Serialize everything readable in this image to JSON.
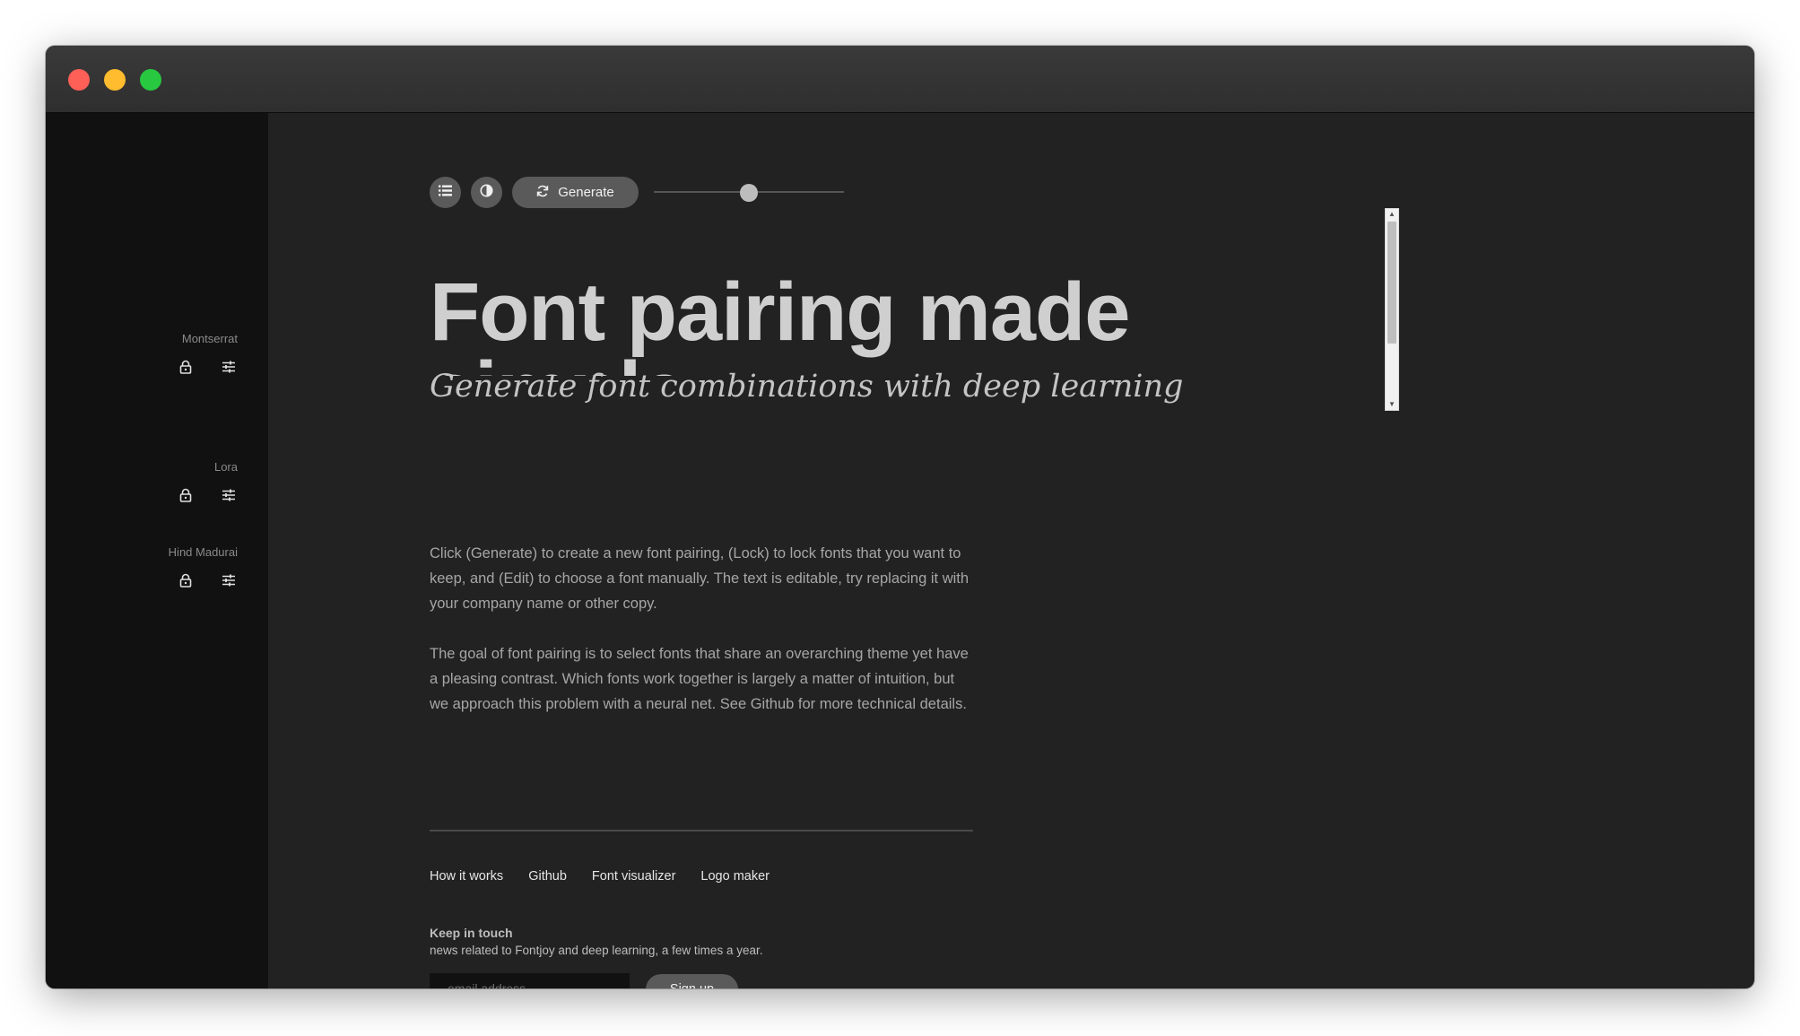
{
  "sidebar": {
    "fonts": [
      {
        "name": "Montserrat"
      },
      {
        "name": "Lora"
      },
      {
        "name": "Hind Madurai"
      }
    ]
  },
  "toolbar": {
    "list_icon": "list-icon",
    "contrast_icon": "contrast-icon",
    "generate_label": "Generate",
    "generate_icon": "refresh-icon",
    "slider_value": 0.5
  },
  "content": {
    "headline": "Font pairing made simple",
    "subheadline": "Generate font combinations with deep learning",
    "paragraph_1": "Click (Generate) to create a new font pairing, (Lock) to lock fonts that you want to keep, and (Edit) to choose a font manually. The text is editable, try replacing it with your company name or other copy.",
    "paragraph_2": "The goal of font pairing is to select fonts that share an overarching theme yet have a pleasing contrast. Which fonts work together is largely a matter of intuition, but we approach this problem with a neural net. See Github for more technical details."
  },
  "footer": {
    "links": [
      "How it works",
      "Github",
      "Font visualizer",
      "Logo maker"
    ],
    "newsletter_title": "Keep in touch",
    "newsletter_desc": "news related to Fontjoy and deep learning, a few times a year.",
    "email_placeholder": "email address",
    "email_value": "",
    "signup_label": "Sign up"
  },
  "colors": {
    "window_bg": "#222222",
    "sidebar_bg": "#111111",
    "button_bg": "#5a5a5a",
    "close": "#fe5f57",
    "minimize": "#febc2e",
    "maximize": "#28c840"
  }
}
